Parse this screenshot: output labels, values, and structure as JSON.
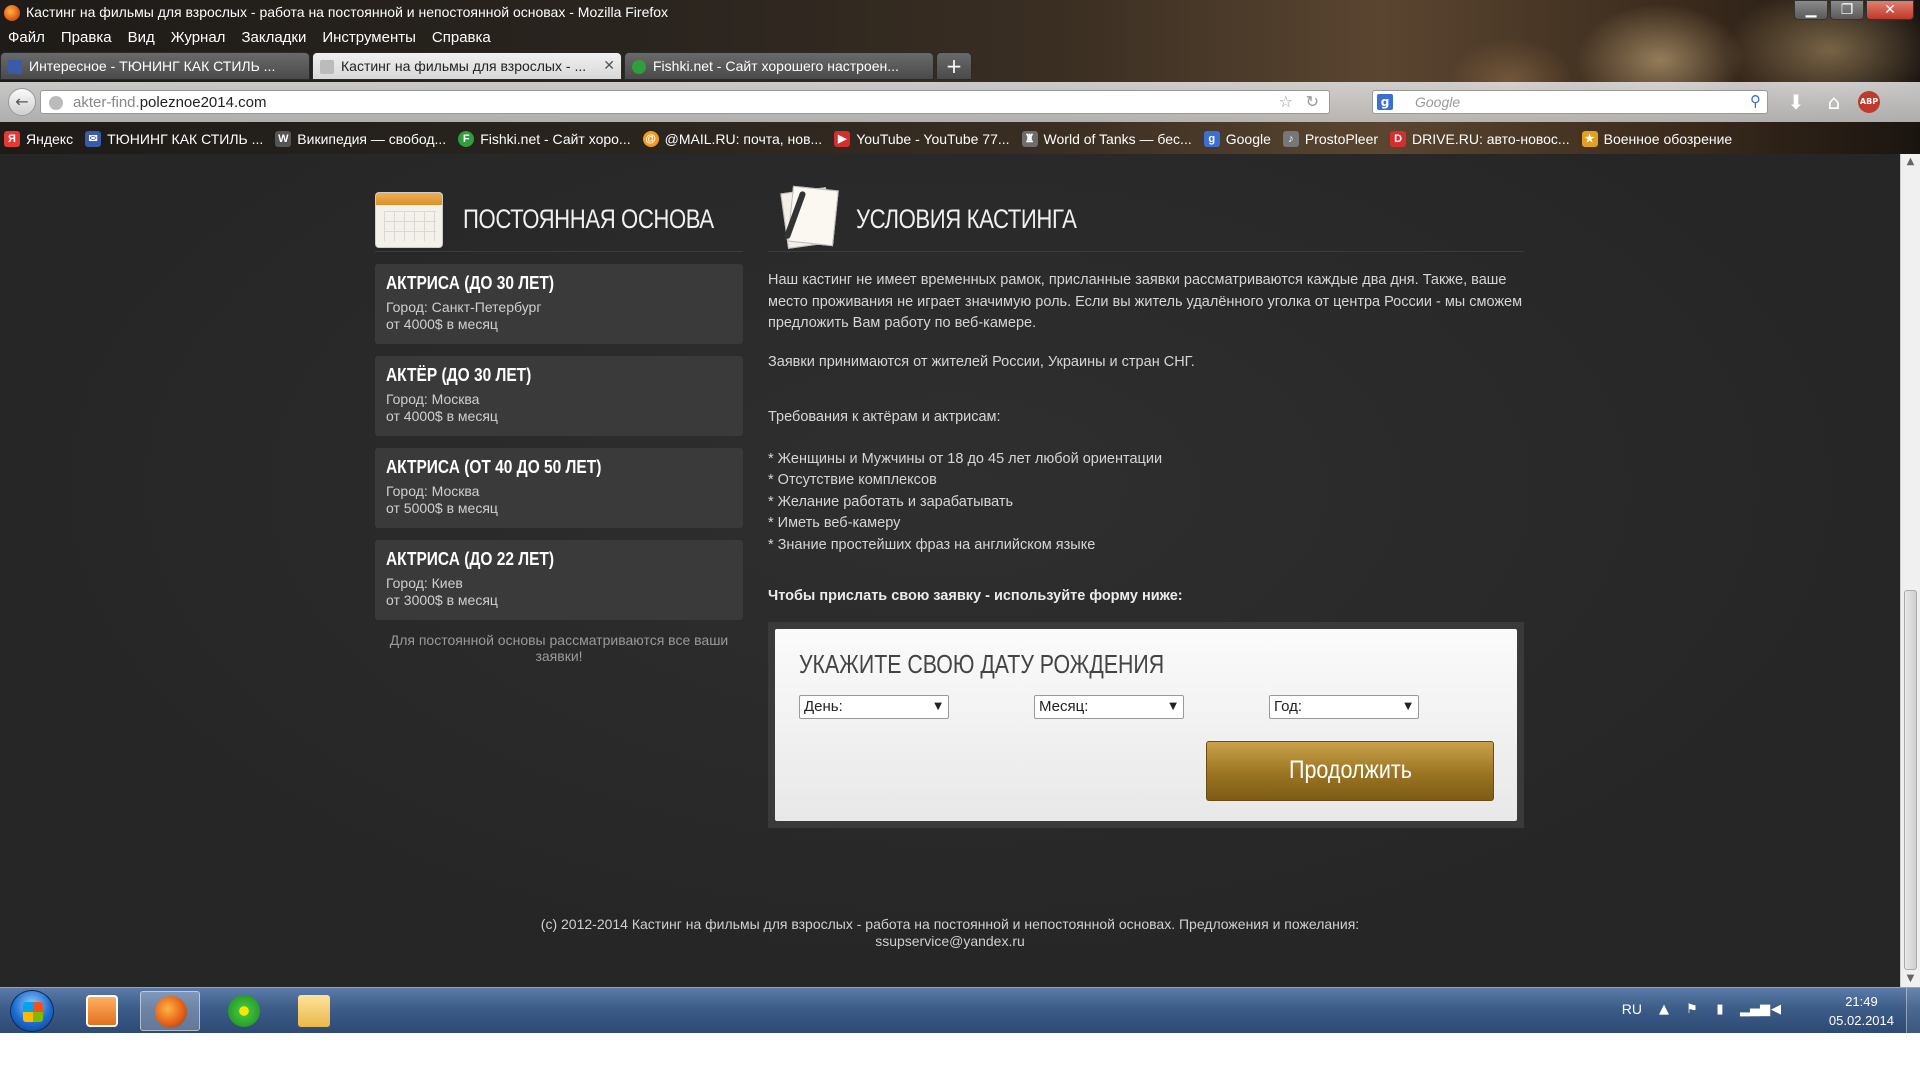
{
  "window": {
    "title": "Кастинг на фильмы для взрослых - работа на постоянной и непостоянной основах - Mozilla Firefox",
    "minimize": "▁",
    "maximize": "❐",
    "close": "✕"
  },
  "menu": [
    "Файл",
    "Правка",
    "Вид",
    "Журнал",
    "Закладки",
    "Инструменты",
    "Справка"
  ],
  "tabs": [
    {
      "label": "Интересное - ТЮНИНГ КАК СТИЛЬ ...",
      "active": false,
      "icon_color": "#3b5aa8"
    },
    {
      "label": "Кастинг на фильмы для взрослых - ...",
      "active": true,
      "icon_color": "#999999",
      "close": "✕"
    },
    {
      "label": "Fishki.net - Сайт хорошего настроен...",
      "active": false,
      "icon_color": "#2e9e3e"
    }
  ],
  "new_tab": "+",
  "navbar": {
    "back": "←",
    "url_prefix": "akter-find.",
    "url_domain": "poleznoe2014.com",
    "star": "☆",
    "reload": "↻",
    "search_engine": "g",
    "search_placeholder": "Google",
    "search_icon": "⚲",
    "download": "⬇",
    "home": "⌂",
    "abp": "ABP"
  },
  "bookmarks": [
    {
      "label": "Яндекс",
      "icon_text": "Я",
      "icon_color": "#e53935"
    },
    {
      "label": "ТЮНИНГ КАК СТИЛЬ ...",
      "icon_text": "✉",
      "icon_color": "#3b5aa8"
    },
    {
      "label": "Википедия — свобод...",
      "icon_text": "W",
      "icon_color": "#555555"
    },
    {
      "label": "Fishki.net - Сайт хоро...",
      "icon_text": "F",
      "icon_color": "#2e9e3e"
    },
    {
      "label": "@MAIL.RU: почта, нов...",
      "icon_text": "@",
      "icon_color": "#f29b1d"
    },
    {
      "label": "YouTube - YouTube 77...",
      "icon_text": "▶",
      "icon_color": "#d32f2f"
    },
    {
      "label": "World of Tanks — бес...",
      "icon_text": "♜",
      "icon_color": "#6d6d6d"
    },
    {
      "label": "Google",
      "icon_text": "g",
      "icon_color": "#3b6fd4"
    },
    {
      "label": "ProstoPleer",
      "icon_text": "♪",
      "icon_color": "#777777"
    },
    {
      "label": "DRIVE.RU: авто-новос...",
      "icon_text": "D",
      "icon_color": "#d32f2f"
    },
    {
      "label": "Военное обозрение",
      "icon_text": "★",
      "icon_color": "#e0a020"
    }
  ],
  "left": {
    "title": "ПОСТОЯННАЯ ОСНОВА",
    "jobs": [
      {
        "title": "АКТРИСА (ДО 30 ЛЕТ)",
        "city": "Город: Санкт-Петербург",
        "salary": "от 4000$ в месяц"
      },
      {
        "title": "АКТЁР (ДО 30 ЛЕТ)",
        "city": "Город: Москва",
        "salary": "от 4000$ в месяц"
      },
      {
        "title": "АКТРИСА (ОТ 40 ДО 50 ЛЕТ)",
        "city": "Город: Москва",
        "salary": "от 5000$ в месяц"
      },
      {
        "title": "АКТРИСА (ДО 22 ЛЕТ)",
        "city": "Город: Киев",
        "salary": "от 3000$ в месяц"
      }
    ],
    "note": "Для постоянной основы рассматриваются все ваши заявки!"
  },
  "right": {
    "title": "УСЛОВИЯ КАСТИНГА",
    "paragraph1": "Наш кастинг не имеет временных рамок, присланные заявки рассматриваются каждые два дня. Также, ваше место проживания не играет значимую роль. Если вы житель удалённого уголка от центра России - мы сможем предложить Вам работу по веб-камере.",
    "paragraph2": "Заявки принимаются от жителей России, Украины и стран СНГ.",
    "requirements_title": "Требования к актёрам и актрисам:",
    "requirements": [
      "* Женщины и Мужчины от 18 до 45 лет любой ориентации",
      "* Отсутствие комплексов",
      "* Желание работать и зарабатывать",
      "* Иметь веб-камеру",
      "* Знание простейших фраз на английском языке"
    ],
    "cta": "Чтобы прислать свою заявку - используйте форму ниже:"
  },
  "form": {
    "title": "УКАЖИТЕ СВОЮ ДАТУ РОЖДЕНИЯ",
    "day": "День:",
    "month": "Месяц:",
    "year": "Год:",
    "continue": "Продолжить"
  },
  "footer": {
    "line1": "(c) 2012-2014 Кастинг на фильмы для взрослых - работа на постоянной и непостоянной основах. Предложения и пожелания:",
    "line2": "ssupservice@yandex.ru"
  },
  "taskbar": {
    "lang": "RU",
    "time": "21:49",
    "date": "05.02.2014"
  }
}
